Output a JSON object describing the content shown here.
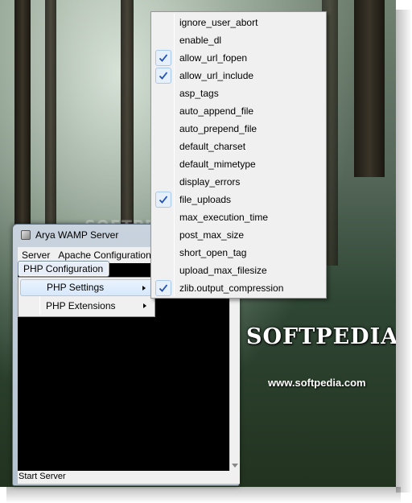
{
  "desktop": {
    "watermark": "SOFTPEDIA",
    "logo": "SOFTPEDIA",
    "logo_mark": "®",
    "url": "www.softpedia.com"
  },
  "app": {
    "title": "Arya WAMP Server",
    "menubar": [
      "Server",
      "Apache Configuration"
    ],
    "status": "Start Server"
  },
  "php_menu": {
    "label": "PHP Configuration",
    "items": [
      {
        "label": "PHP Settings",
        "has_submenu": true,
        "highlighted": true
      },
      {
        "label": "PHP Extensions",
        "has_submenu": true,
        "highlighted": false
      }
    ]
  },
  "settings_menu": {
    "items": [
      {
        "label": "ignore_user_abort",
        "checked": false
      },
      {
        "label": "enable_dl",
        "checked": false
      },
      {
        "label": "allow_url_fopen",
        "checked": true
      },
      {
        "label": "allow_url_include",
        "checked": true
      },
      {
        "label": "asp_tags",
        "checked": false
      },
      {
        "label": "auto_append_file",
        "checked": false
      },
      {
        "label": "auto_prepend_file",
        "checked": false
      },
      {
        "label": "default_charset",
        "checked": false
      },
      {
        "label": "default_mimetype",
        "checked": false
      },
      {
        "label": "display_errors",
        "checked": false
      },
      {
        "label": "file_uploads",
        "checked": true
      },
      {
        "label": "max_execution_time",
        "checked": false
      },
      {
        "label": "post_max_size",
        "checked": false
      },
      {
        "label": "short_open_tag",
        "checked": false
      },
      {
        "label": "upload_max_filesize",
        "checked": false
      },
      {
        "label": "zlib.output_compression",
        "checked": true
      }
    ]
  },
  "colors": {
    "check": "#1f4fb5",
    "menu_bg": "#f0f0f0",
    "console_bg": "#000000"
  }
}
